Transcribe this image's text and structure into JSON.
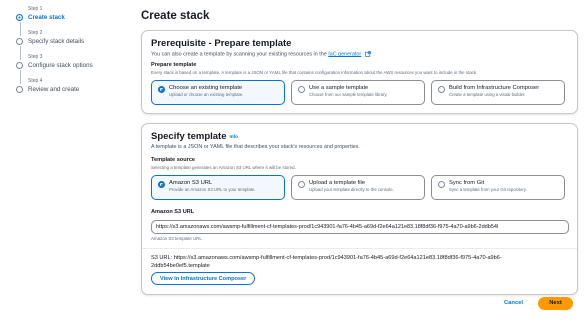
{
  "steps": [
    {
      "num": "Step 1",
      "name": "Create stack",
      "active": true
    },
    {
      "num": "Step 2",
      "name": "Specify stack details"
    },
    {
      "num": "Step 3",
      "name": "Configure stack options"
    },
    {
      "num": "Step 4",
      "name": "Review and create"
    }
  ],
  "page_title": "Create stack",
  "prerequisite": {
    "title": "Prerequisite - Prepare template",
    "desc_prefix": "You can also create a template by scanning your existing resources in the",
    "desc_link": "IaC generator",
    "field_label": "Prepare template",
    "field_desc": "Every stack is based on a template. A template is a JSON or YAML file that contains configuration information about the AWS resources you want to include in the stack.",
    "options": [
      {
        "label": "Choose an existing template",
        "desc": "Upload or choose an existing template.",
        "selected": true
      },
      {
        "label": "Use a sample template",
        "desc": "Choose from our sample template library."
      },
      {
        "label": "Build from Infrastructure Composer",
        "desc": "Create a template using a visual builder."
      }
    ]
  },
  "specify": {
    "title": "Specify template",
    "info": "Info",
    "desc": "A template is a JSON or YAML file that describes your stack's resources and properties.",
    "source_label": "Template source",
    "source_desc": "Selecting a template generates an Amazon S3 URL where it will be stored.",
    "options": [
      {
        "label": "Amazon S3 URL",
        "desc": "Provide an Amazon S3 URL to your template.",
        "selected": true
      },
      {
        "label": "Upload a template file",
        "desc": "Upload your template directly to the console."
      },
      {
        "label": "Sync from Git",
        "desc": "Sync a template from your Git repository."
      }
    ],
    "url_label": "Amazon S3 URL",
    "url_value": "https://s3.amazonaws.com/awsmp-fulfillment-cf-templates-prod/1c943901-fa76-4b45-a69d-f2e64a121e83.18f8df36-f975-4a70-a9b6-2ddb54l",
    "url_hint": "Amazon S3 template URL",
    "s3_url_line1": "S3 URL:  https://s3.amazonaws.com/awsmp-fulfillment-cf-templates-prod/1c943901-fa76-4b45-a69d-f2e64a121e83.18f8df36-f975-4a70-a9b6-",
    "s3_url_line2": "2ddb54be0ef5.template",
    "composer_button": "View in Infrastructure Composer"
  },
  "footer": {
    "cancel": "Cancel",
    "next": "Next"
  },
  "colors": {
    "accent": "#0972d3",
    "primary_button": "#ff9900"
  }
}
